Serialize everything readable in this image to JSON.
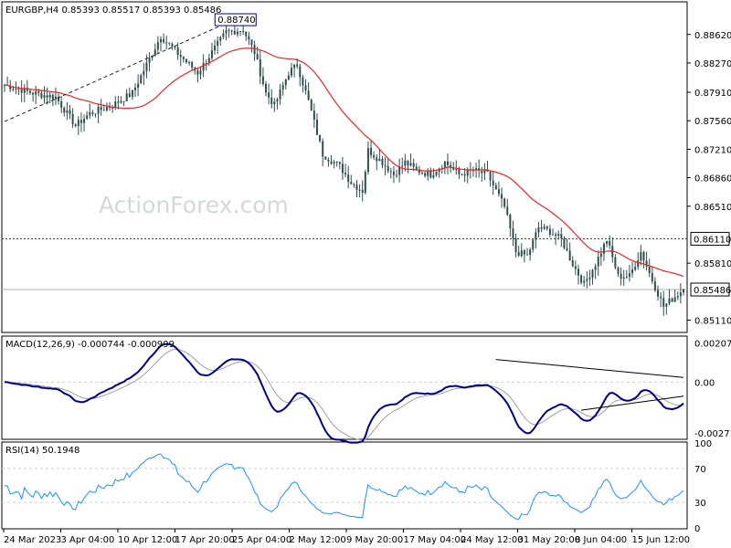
{
  "header": {
    "price_panel": "EURGBP,H4  0.85393 0.85517 0.85393 0.85486",
    "macd_panel": "MACD(12,26,9) -0.000744 -0.000999",
    "rsi_panel": "RSI(14) 50.1948"
  },
  "watermark": "ActionForex.com",
  "colors": {
    "candle": "#2f4f4f",
    "sma": "#e8262a",
    "macd": "#00008b",
    "signal": "#a0a0a0",
    "rsi": "#1e90ff",
    "grid": "#cfcfcf",
    "trend": "#000000"
  },
  "chart_data": [
    {
      "type": "candlestick",
      "symbol": "EURGBP",
      "timeframe": "H4",
      "ohlc_last": {
        "open": 0.85393,
        "high": 0.85517,
        "low": 0.85393,
        "close": 0.85486
      },
      "ylim": [
        0.8497,
        0.8901
      ],
      "y_ticks": [
        "0.88620",
        "0.88270",
        "0.87910",
        "0.87560",
        "0.87210",
        "0.86860",
        "0.86510",
        "0.85810",
        "0.85110"
      ],
      "price_labels": {
        "current": "0.85486",
        "level": "0.86110",
        "high_marker": "0.88740"
      },
      "x_labels": [
        "24 Mar 2023",
        "3 Apr 04:00",
        "10 Apr 12:00",
        "17 Apr 20:00",
        "25 Apr 04:00",
        "2 May 12:00",
        "9 May 20:00",
        "17 May 04:00",
        "24 May 12:00",
        "31 May 20:00",
        "8 Jun 04:00",
        "15 Jun 12:00"
      ],
      "series": [
        {
          "kind": "close_path",
          "x": [
            0,
            1,
            2,
            3,
            4,
            5,
            6,
            7,
            8,
            9,
            10,
            11,
            12,
            13,
            14,
            15,
            16,
            17,
            18,
            19,
            20,
            21,
            22,
            23,
            24,
            25,
            26,
            27,
            28,
            29,
            30,
            31,
            32,
            33,
            34,
            35,
            36,
            37,
            38,
            39,
            40,
            41,
            42,
            43,
            44,
            45,
            46,
            47,
            48,
            49,
            50,
            51,
            52,
            53,
            54,
            55,
            56,
            57,
            58,
            59,
            60,
            61,
            62,
            63,
            64,
            65,
            66,
            67,
            68,
            69,
            70,
            71,
            72,
            73,
            74,
            75,
            76,
            77,
            78,
            79,
            80,
            81,
            82,
            83,
            84,
            85,
            86,
            87,
            88,
            89,
            90,
            91,
            92,
            93,
            94,
            95,
            96,
            97,
            98,
            99,
            100,
            101,
            102,
            103,
            104,
            105,
            106,
            107,
            108,
            109,
            110,
            111,
            112,
            113,
            114,
            115,
            116,
            117,
            118,
            119,
            120,
            121,
            122,
            123,
            124,
            125,
            126,
            127,
            128,
            129,
            130,
            131,
            132,
            133,
            134,
            135,
            136,
            137,
            138,
            139,
            140,
            141,
            142,
            143,
            144,
            145,
            146,
            147,
            148,
            149,
            150,
            151,
            152,
            153,
            154,
            155,
            156,
            157,
            158,
            159,
            160,
            161,
            162,
            163,
            164,
            165,
            166,
            167,
            168,
            169,
            170,
            171,
            172,
            173,
            174,
            175,
            176,
            177,
            178,
            179,
            180,
            181,
            182,
            183,
            184,
            185,
            186,
            187,
            188,
            189,
            190,
            191,
            192,
            193,
            194,
            195,
            196,
            197,
            198,
            199,
            200,
            201,
            202,
            203,
            204,
            205,
            206,
            207,
            208,
            209,
            210,
            211,
            212,
            213,
            214,
            215,
            216,
            217,
            218,
            219,
            220,
            221,
            222,
            223,
            224,
            225,
            226,
            227,
            228,
            229,
            230,
            231,
            232,
            233,
            234,
            235,
            236,
            237,
            238,
            239
          ],
          "values_key": "computed"
        }
      ],
      "waypoints": [
        [
          0,
          0.88
        ],
        [
          10,
          0.879
        ],
        [
          18,
          0.8785
        ],
        [
          25,
          0.875
        ],
        [
          30,
          0.8765
        ],
        [
          38,
          0.8775
        ],
        [
          45,
          0.879
        ],
        [
          50,
          0.8825
        ],
        [
          55,
          0.886
        ],
        [
          62,
          0.8835
        ],
        [
          68,
          0.8815
        ],
        [
          72,
          0.8835
        ],
        [
          78,
          0.8865
        ],
        [
          84,
          0.8868
        ],
        [
          88,
          0.884
        ],
        [
          92,
          0.879
        ],
        [
          95,
          0.8775
        ],
        [
          100,
          0.8815
        ],
        [
          103,
          0.8825
        ],
        [
          107,
          0.878
        ],
        [
          112,
          0.8715
        ],
        [
          118,
          0.87
        ],
        [
          122,
          0.868
        ],
        [
          126,
          0.867
        ],
        [
          128,
          0.872
        ],
        [
          133,
          0.8705
        ],
        [
          137,
          0.869
        ],
        [
          141,
          0.8705
        ],
        [
          145,
          0.8695
        ],
        [
          150,
          0.869
        ],
        [
          155,
          0.8705
        ],
        [
          160,
          0.869
        ],
        [
          165,
          0.8695
        ],
        [
          170,
          0.869
        ],
        [
          176,
          0.865
        ],
        [
          180,
          0.8595
        ],
        [
          184,
          0.859
        ],
        [
          188,
          0.8625
        ],
        [
          192,
          0.862
        ],
        [
          196,
          0.861
        ],
        [
          200,
          0.858
        ],
        [
          204,
          0.8555
        ],
        [
          208,
          0.858
        ],
        [
          212,
          0.861
        ],
        [
          216,
          0.8565
        ],
        [
          220,
          0.8565
        ],
        [
          224,
          0.8595
        ],
        [
          228,
          0.856
        ],
        [
          232,
          0.8528
        ],
        [
          236,
          0.854
        ],
        [
          239,
          0.8549
        ]
      ],
      "sma_line": "red moving average",
      "level_line": 0.8611,
      "current_line": 0.85486,
      "trendline_from": {
        "index": 0,
        "value": 0.8755
      },
      "trendline_to": {
        "index": 84,
        "value": 0.8885
      }
    },
    {
      "type": "line",
      "name": "MACD(12,26,9)",
      "ylim": [
        -0.003,
        0.0024
      ],
      "y_ticks": [
        "0.002074",
        "0.00",
        "-0.002716"
      ],
      "zero_line": 0,
      "trendline_upper": [
        [
          173,
          0.0012
        ],
        [
          240,
          0.00025
        ]
      ],
      "trendline_lower": [
        [
          203,
          -0.0015
        ],
        [
          240,
          -0.00075
        ]
      ]
    },
    {
      "type": "line",
      "name": "RSI(14)",
      "ylim": [
        0,
        100
      ],
      "y_ticks": [
        "100",
        "70",
        "30",
        "0"
      ],
      "levels": [
        70,
        30
      ],
      "last": 50.1948
    }
  ]
}
